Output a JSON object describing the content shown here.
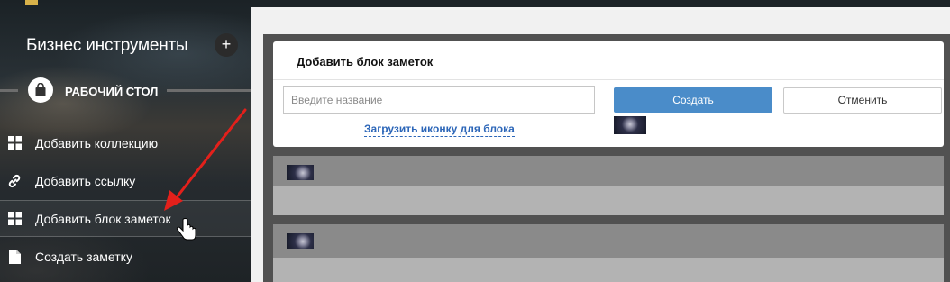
{
  "sidebar": {
    "title": "Бизнес инструменты",
    "add_button": "+",
    "workspace": {
      "label": "РАБОЧИЙ СТОЛ",
      "icon": "shopping-bag-icon"
    },
    "items": [
      {
        "label": "Добавить коллекцию",
        "icon": "grid-icon"
      },
      {
        "label": "Добавить ссылку",
        "icon": "link-icon"
      },
      {
        "label": "Добавить блок заметок",
        "icon": "grid-icon",
        "active": true
      },
      {
        "label": "Создать заметку",
        "icon": "document-icon"
      }
    ]
  },
  "dialog": {
    "title": "Добавить блок заметок",
    "name_placeholder": "Введите название",
    "create_label": "Создать",
    "cancel_label": "Отменить",
    "upload_label": "Загрузить иконку для блока"
  },
  "colors": {
    "accent": "#4a8cc9",
    "link": "#2c66b8",
    "annotation_arrow": "#e3201b"
  }
}
